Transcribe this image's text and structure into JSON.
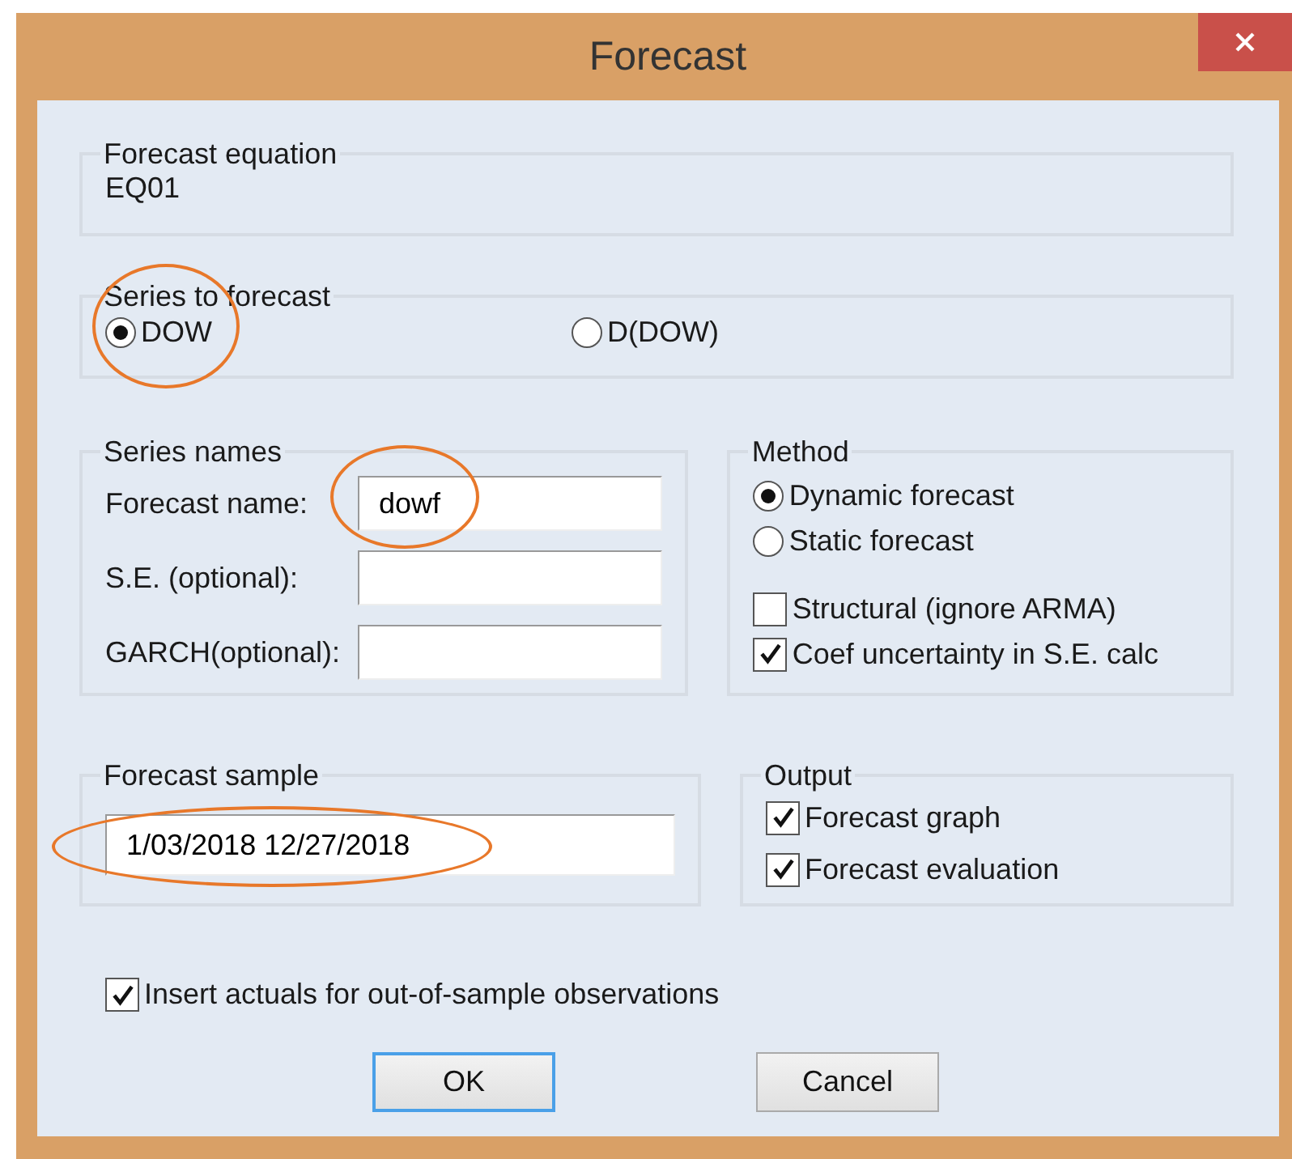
{
  "window": {
    "title": "Forecast"
  },
  "equation": {
    "legend": "Forecast equation",
    "value": "EQ01"
  },
  "series": {
    "legend": "Series to forecast",
    "options": [
      {
        "label": "DOW",
        "selected": true,
        "circled": true
      },
      {
        "label": "D(DOW)",
        "selected": false,
        "circled": false
      }
    ]
  },
  "series_names": {
    "legend": "Series names",
    "fields": [
      {
        "label": "Forecast name:",
        "value": "dowf",
        "circled": true
      },
      {
        "label": "S.E. (optional):",
        "circled": false
      },
      {
        "label": "GARCH(optional):",
        "circled": false
      }
    ]
  },
  "method": {
    "legend": "Method",
    "options": [
      {
        "kind": "radio",
        "label": "Dynamic forecast",
        "selected": true
      },
      {
        "kind": "radio",
        "label": "Static forecast",
        "selected": false
      },
      {
        "kind": "checkbox",
        "label": "Structural (ignore ARMA)",
        "checked": false
      },
      {
        "kind": "checkbox",
        "label": "Coef uncertainty in S.E. calc",
        "checked": true
      }
    ]
  },
  "sample": {
    "legend": "Forecast sample",
    "value": "1/03/2018 12/27/2018",
    "circled": true
  },
  "output": {
    "legend": "Output",
    "options": [
      {
        "label": "Forecast graph",
        "checked": true
      },
      {
        "label": "Forecast evaluation",
        "checked": true
      }
    ]
  },
  "insert_actuals": {
    "label": "Insert actuals for out-of-sample observations",
    "checked": true
  },
  "buttons": [
    {
      "label": "OK",
      "default": true
    },
    {
      "label": "Cancel",
      "default": false
    }
  ]
}
